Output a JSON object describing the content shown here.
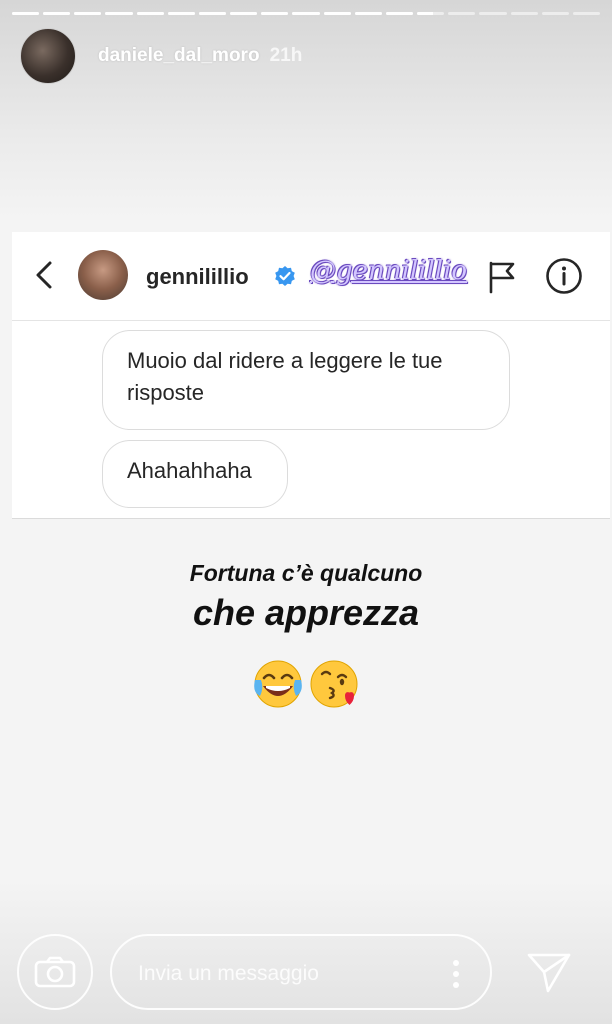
{
  "story": {
    "username": "daniele_dal_moro",
    "time": "21h",
    "segments": [
      1,
      1,
      1,
      1,
      1,
      1,
      1,
      1,
      1,
      1,
      1,
      1,
      1,
      0.6,
      0,
      0,
      0,
      0,
      0
    ]
  },
  "dm": {
    "username": "gennilillio",
    "mention": "@gennilillio",
    "messages": [
      "Muoio dal ridere a leggere le tue risposte",
      "Ahahahhaha"
    ]
  },
  "caption": {
    "line1": "Fortuna c’è qualcuno",
    "line2": "che apprezza",
    "emojis": [
      "face-with-tears-of-joy",
      "face-blowing-a-kiss"
    ]
  },
  "reply": {
    "placeholder": "Invia un messaggio"
  },
  "colors": {
    "verified": "#3897f0",
    "mention_outline": "#6b4bbf"
  }
}
